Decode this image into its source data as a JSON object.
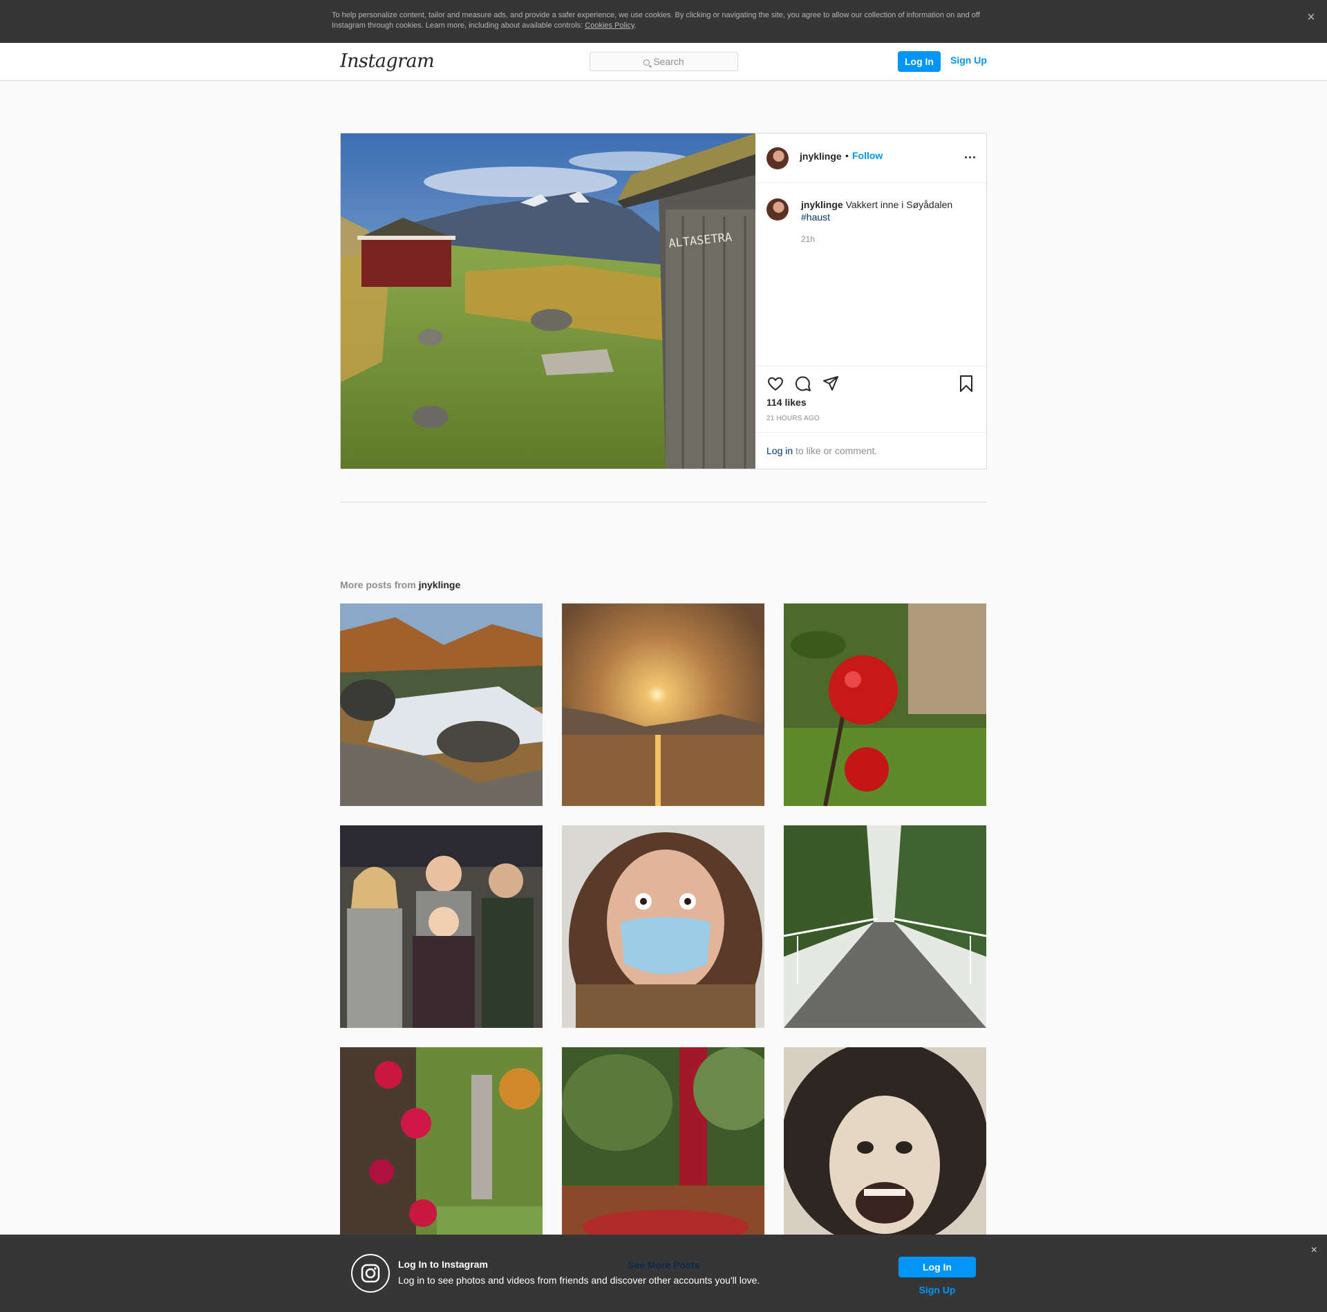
{
  "cookie_banner": {
    "text": "To help personalize content, tailor and measure ads, and provide a safer experience, we use cookies. By clicking or navigating the site, you agree to allow our collection of information on and off Instagram through cookies. Learn more, including about available controls: ",
    "link": "Cookies Policy",
    "end": ".",
    "close": "×"
  },
  "nav": {
    "logo": "Instagram",
    "search_placeholder": "Search",
    "login": "Log In",
    "signup": "Sign Up"
  },
  "post": {
    "username": "jnyklinge",
    "separator": "•",
    "follow": "Follow",
    "more": "...",
    "caption_user": "jnyklinge",
    "caption_text": "Vakkert inne i Søyådalen",
    "hashtag": "#haust",
    "time_short": "21h",
    "likes": "114 likes",
    "time_long": "21 HOURS AGO",
    "login_link": "Log in",
    "login_rest": " to like or comment.",
    "sign_text": "ALTASETRA"
  },
  "more_posts": {
    "prefix": "More posts from ",
    "user": "jnyklinge"
  },
  "bottom_bar": {
    "title": "Log In to Instagram",
    "description": "Log in to see photos and videos from friends and discover other accounts you'll love.",
    "see_more": "See More Posts",
    "login": "Log In",
    "signup": "Sign Up",
    "close": "×"
  },
  "colors": {
    "accent": "#0095f6",
    "link_dark": "#00376b"
  }
}
